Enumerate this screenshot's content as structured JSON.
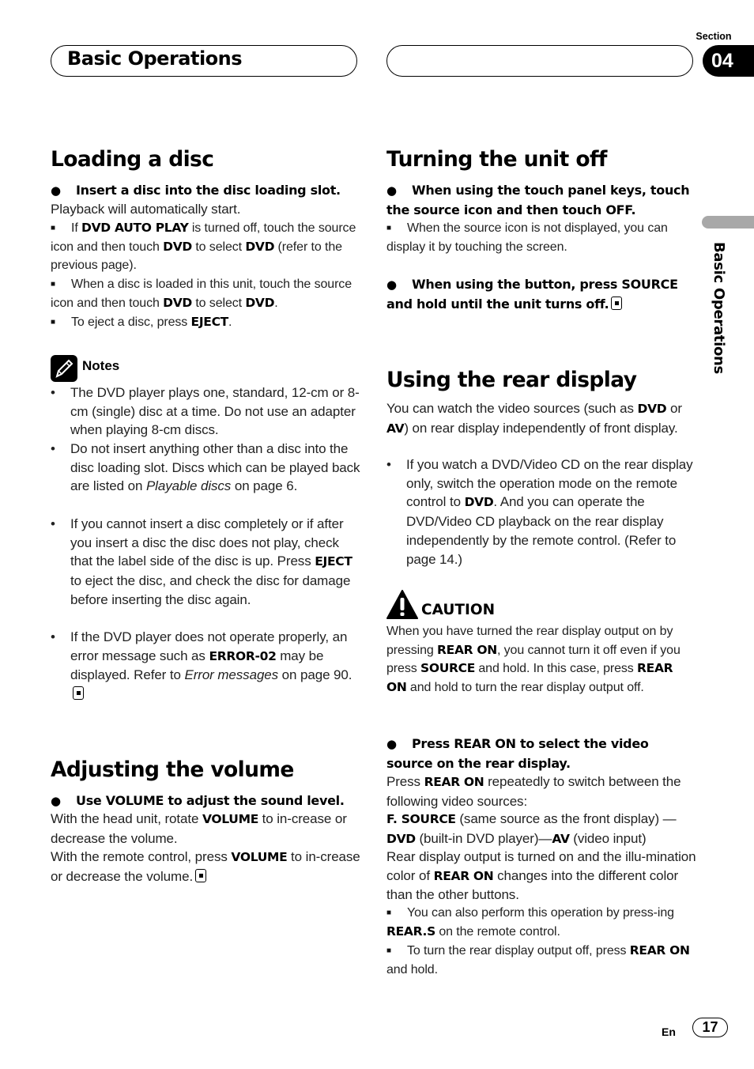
{
  "header": {
    "title": "Basic Operations",
    "section_label": "Section",
    "section_number": "04"
  },
  "side_label": "Basic Operations",
  "loading_disc": {
    "title": "Loading a disc",
    "step": "Insert a disc into the disc loading slot.",
    "step_desc": "Playback will automatically start.",
    "tip1": [
      "If ",
      "DVD AUTO PLAY",
      " is turned off, touch the source icon and then touch ",
      "DVD",
      " to select ",
      "DVD",
      " (refer to the previous page)."
    ],
    "tip2": [
      "When a disc is loaded in this unit, touch the source icon and then touch ",
      "DVD",
      " to select ",
      "DVD",
      "."
    ],
    "tip3": [
      "To eject a disc, press ",
      "EJECT",
      "."
    ]
  },
  "notes": {
    "title": "Notes",
    "items": [
      {
        "parts": [
          "The DVD player plays one, standard, 12-cm or 8-cm (single) disc at a time. Do not use an adapter when playing 8-cm discs."
        ]
      },
      {
        "parts": [
          "Do not insert anything other than a disc into the disc loading slot. Discs which can be played back are listed on ",
          "Playable discs",
          " on page 6."
        ]
      },
      {
        "parts": [
          "If you cannot insert a disc completely or if after you insert a disc the disc does not play, check that the label side of the disc is up. Press ",
          "EJECT",
          " to eject the disc, and check the disc for damage before inserting the disc again."
        ]
      },
      {
        "parts": [
          "If the DVD player does not operate properly, an error message such as ",
          "ERROR-02",
          " may be displayed. Refer to ",
          "Error messages",
          " on page 90."
        ]
      }
    ]
  },
  "volume": {
    "title": "Adjusting the volume",
    "step": "Use VOLUME to adjust the sound level.",
    "line1": [
      "With the head unit, rotate ",
      "VOLUME",
      " to in-crease or decrease the volume."
    ],
    "line2": [
      "With the remote control, press ",
      "VOLUME",
      " to in-crease or decrease the volume."
    ]
  },
  "turning_off": {
    "title": "Turning the unit off",
    "step1": "When using the touch panel keys, touch the source icon and then touch OFF.",
    "tip1": "When the source icon is not displayed, you can display it by touching the screen.",
    "step2": "When using the button, press SOURCE and hold until the unit turns off."
  },
  "rear_display": {
    "title": "Using the rear display",
    "intro": [
      "You can watch the video sources (such as ",
      "DVD",
      " or ",
      "AV",
      ") on rear display independently of front display."
    ],
    "bullet": [
      "If you watch a DVD/Video CD on the rear display only, switch the operation mode on the remote control to ",
      "DVD",
      ". And you can operate the DVD/Video CD playback on the rear display independently by the remote control. (Refer to page 14.)"
    ],
    "caution_title": "CAUTION",
    "caution_text": [
      "When you have turned the rear display output on by pressing ",
      "REAR ON",
      ", you cannot turn it off even if you press ",
      "SOURCE",
      " and hold. In this case, press ",
      "REAR ON",
      " and hold to turn the rear display output off."
    ],
    "step": "Press REAR ON to select the video source on the rear display.",
    "desc1": [
      "Press ",
      "REAR ON",
      " repeatedly to switch between the following video sources:"
    ],
    "desc2": [
      "F. SOURCE",
      " (same source as the front display) —",
      "DVD",
      " (built-in DVD player)—",
      "AV",
      " (video input)"
    ],
    "desc3": [
      "Rear display output is turned on and the illu-mination color of ",
      "REAR ON",
      " changes into the different color than the other buttons."
    ],
    "tip1": [
      "You can also perform this operation by press-ing ",
      "REAR.S",
      " on the remote control."
    ],
    "tip2": [
      "To turn the rear display output off, press ",
      "REAR ON",
      " and hold."
    ]
  },
  "footer": {
    "lang": "En",
    "page": "17"
  }
}
